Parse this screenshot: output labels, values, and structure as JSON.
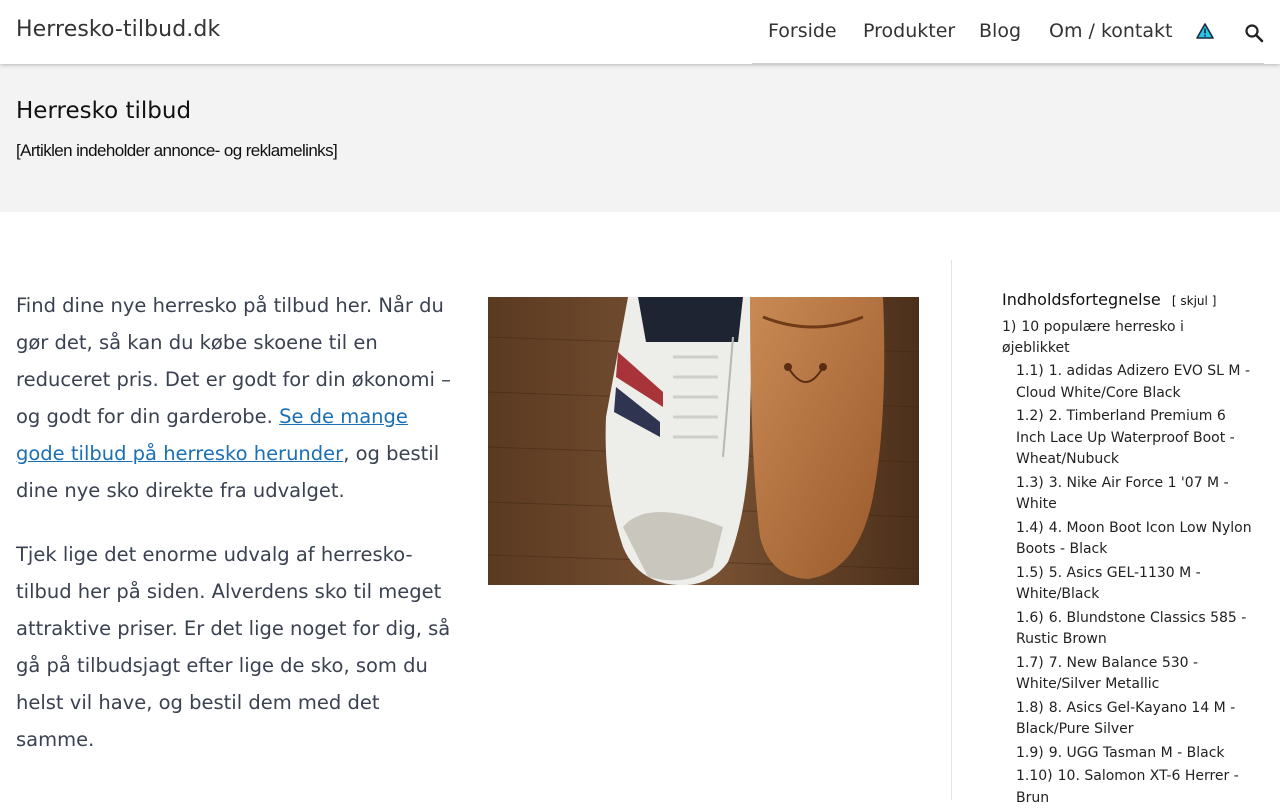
{
  "header": {
    "site_title": "Herresko-tilbud.dk",
    "nav": [
      "Forside",
      "Produkter",
      "Blog",
      "Om / kontakt"
    ],
    "icons": [
      "warning-triangle-icon",
      "search-icon"
    ]
  },
  "hero": {
    "title": "Herresko tilbud",
    "disclaimer": "[Artiklen indeholder annonce- og reklamelinks]"
  },
  "main": {
    "p1_before": "Find dine nye herresko på tilbud her. Når du gør det, så kan du købe skoene til en reduceret pris. Det er godt for din økonomi – og godt for din garderobe. ",
    "p1_link": "Se de mange gode tilbud på herresko herunder",
    "p1_after": ", og bestil dine nye sko direkte fra udvalget.",
    "p2": "Tjek lige det enorme udvalg af herresko-tilbud her på siden. Alverdens sko til meget attraktive priser. Er det lige noget for dig, så gå på tilbudsjagt efter lige de sko, som du helst vil have, og bestil dem med det samme."
  },
  "toc": {
    "title": "Indholdsfortegnelse",
    "toggle_open": "[",
    "toggle_label": "skjul",
    "toggle_close": "]",
    "section": {
      "num": "1)",
      "label": "10 populære herresko i øjeblikket"
    },
    "items": [
      {
        "num": "1.1)",
        "label": "1. adidas Adizero EVO SL M - Cloud White/Core Black"
      },
      {
        "num": "1.2)",
        "label": "2. Timberland Premium 6 Inch Lace Up Waterproof Boot - Wheat/Nubuck"
      },
      {
        "num": "1.3)",
        "label": "3. Nike Air Force 1 '07 M - White"
      },
      {
        "num": "1.4)",
        "label": "4. Moon Boot Icon Low Nylon Boots - Black"
      },
      {
        "num": "1.5)",
        "label": "5. Asics GEL-1130 M - White/Black"
      },
      {
        "num": "1.6)",
        "label": "6. Blundstone Classics 585 - Rustic Brown"
      },
      {
        "num": "1.7)",
        "label": "7. New Balance 530 - White/Silver Metallic"
      },
      {
        "num": "1.8)",
        "label": "8. Asics Gel-Kayano 14 M - Black/Pure Silver"
      },
      {
        "num": "1.9)",
        "label": "9. UGG Tasman M - Black"
      },
      {
        "num": "1.10)",
        "label": "10. Salomon XT-6 Herrer - Brun"
      }
    ]
  },
  "colors": {
    "link": "#1a6fb5",
    "text": "#3a4150",
    "hero_bg": "#f3f3f3"
  }
}
